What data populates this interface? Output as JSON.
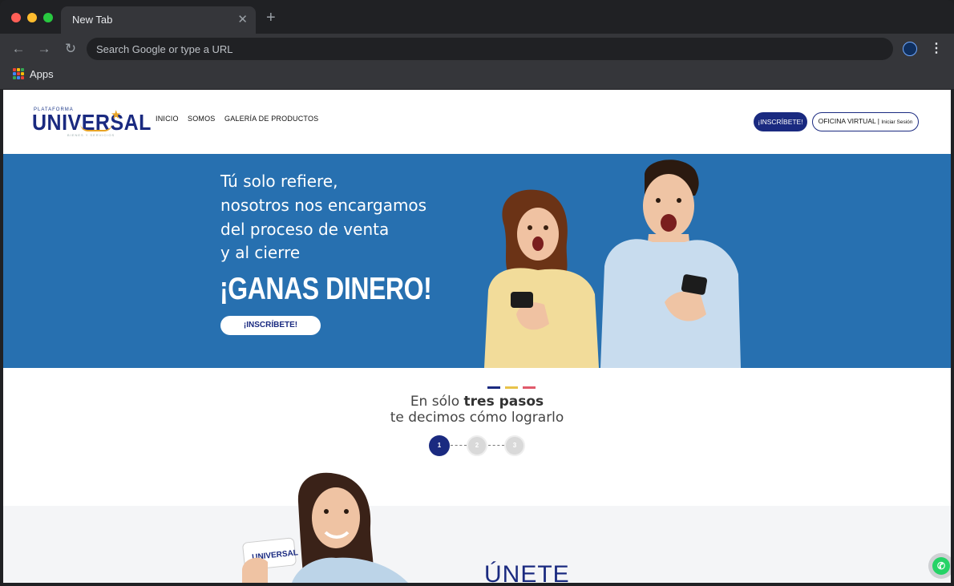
{
  "browser": {
    "tab_title": "New Tab",
    "tab_close": "✕",
    "new_tab": "+",
    "back": "←",
    "forward": "→",
    "reload": "↻",
    "omnibox_placeholder": "Search Google or type a URL",
    "menu": "⋮",
    "bookmarks": {
      "apps_label": "Apps"
    }
  },
  "site": {
    "logo": {
      "top": "PLATAFORMA",
      "main": "UNIVERSAL",
      "sub": "BIENES Y SERVICIOS"
    },
    "nav": [
      "INICIO",
      "SOMOS",
      "GALERÍA DE PRODUCTOS"
    ],
    "cta_signup": "¡INSCRÍBETE!",
    "cta_office": "OFICINA VIRTUAL",
    "cta_office_sep": " | ",
    "cta_office_login": "Iniciar Sesión"
  },
  "hero": {
    "lines": [
      "Tú solo refiere,",
      "nosotros nos encargamos",
      "del proceso de venta",
      "y al cierre"
    ],
    "headline": "¡GANAS DINERO!",
    "button": "¡INSCRÍBETE!"
  },
  "steps": {
    "line1_prefix": "En sólo ",
    "line1_bold": "tres pasos",
    "line2": "te decimos cómo lograrlo",
    "numbers": [
      "1",
      "2",
      "3"
    ],
    "active_step": 1,
    "accent_colors": [
      "#1a2a80",
      "#e8c34a",
      "#e05a6b"
    ]
  },
  "join": {
    "heading": "ÚNETE",
    "card_text": "UNIVERSAL"
  },
  "colors": {
    "brand_blue": "#1a2a80",
    "hero_blue": "#2770b0",
    "whatsapp_green": "#25d366"
  }
}
